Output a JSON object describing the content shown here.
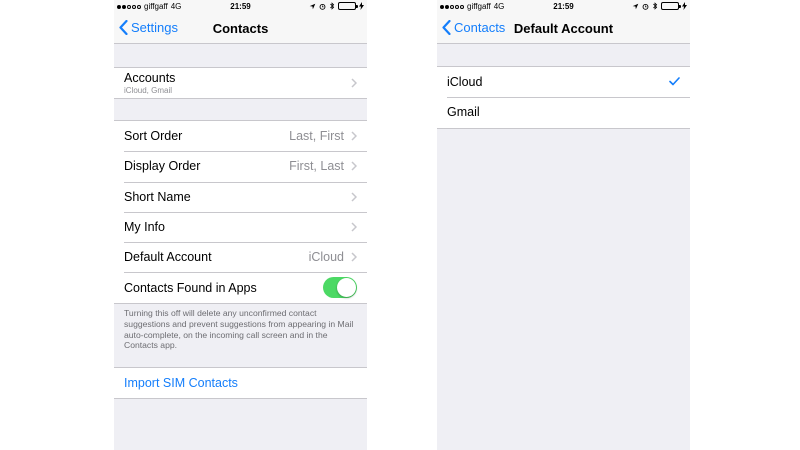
{
  "status_bar": {
    "carrier": "giffgaff",
    "network": "4G",
    "time": "21:59"
  },
  "left_screen": {
    "nav": {
      "back_label": "Settings",
      "title": "Contacts"
    },
    "accounts": {
      "label": "Accounts",
      "sub": "iCloud, Gmail"
    },
    "settings": [
      {
        "label": "Sort Order",
        "value": "Last, First"
      },
      {
        "label": "Display Order",
        "value": "First, Last"
      },
      {
        "label": "Short Name",
        "value": ""
      },
      {
        "label": "My Info",
        "value": ""
      },
      {
        "label": "Default Account",
        "value": "iCloud"
      },
      {
        "label": "Contacts Found in Apps",
        "toggle_on": true
      }
    ],
    "footnote": "Turning this off will delete any unconfirmed contact suggestions and prevent suggestions from appearing in Mail auto-complete, on the incoming call screen and in the Contacts app.",
    "import_label": "Import SIM Contacts"
  },
  "right_screen": {
    "nav": {
      "back_label": "Contacts",
      "title": "Default Account"
    },
    "options": [
      {
        "label": "iCloud",
        "selected": true
      },
      {
        "label": "Gmail",
        "selected": false
      }
    ]
  },
  "colors": {
    "accent": "#147efb",
    "toggle_on": "#4cd964",
    "background": "#efeff4"
  }
}
